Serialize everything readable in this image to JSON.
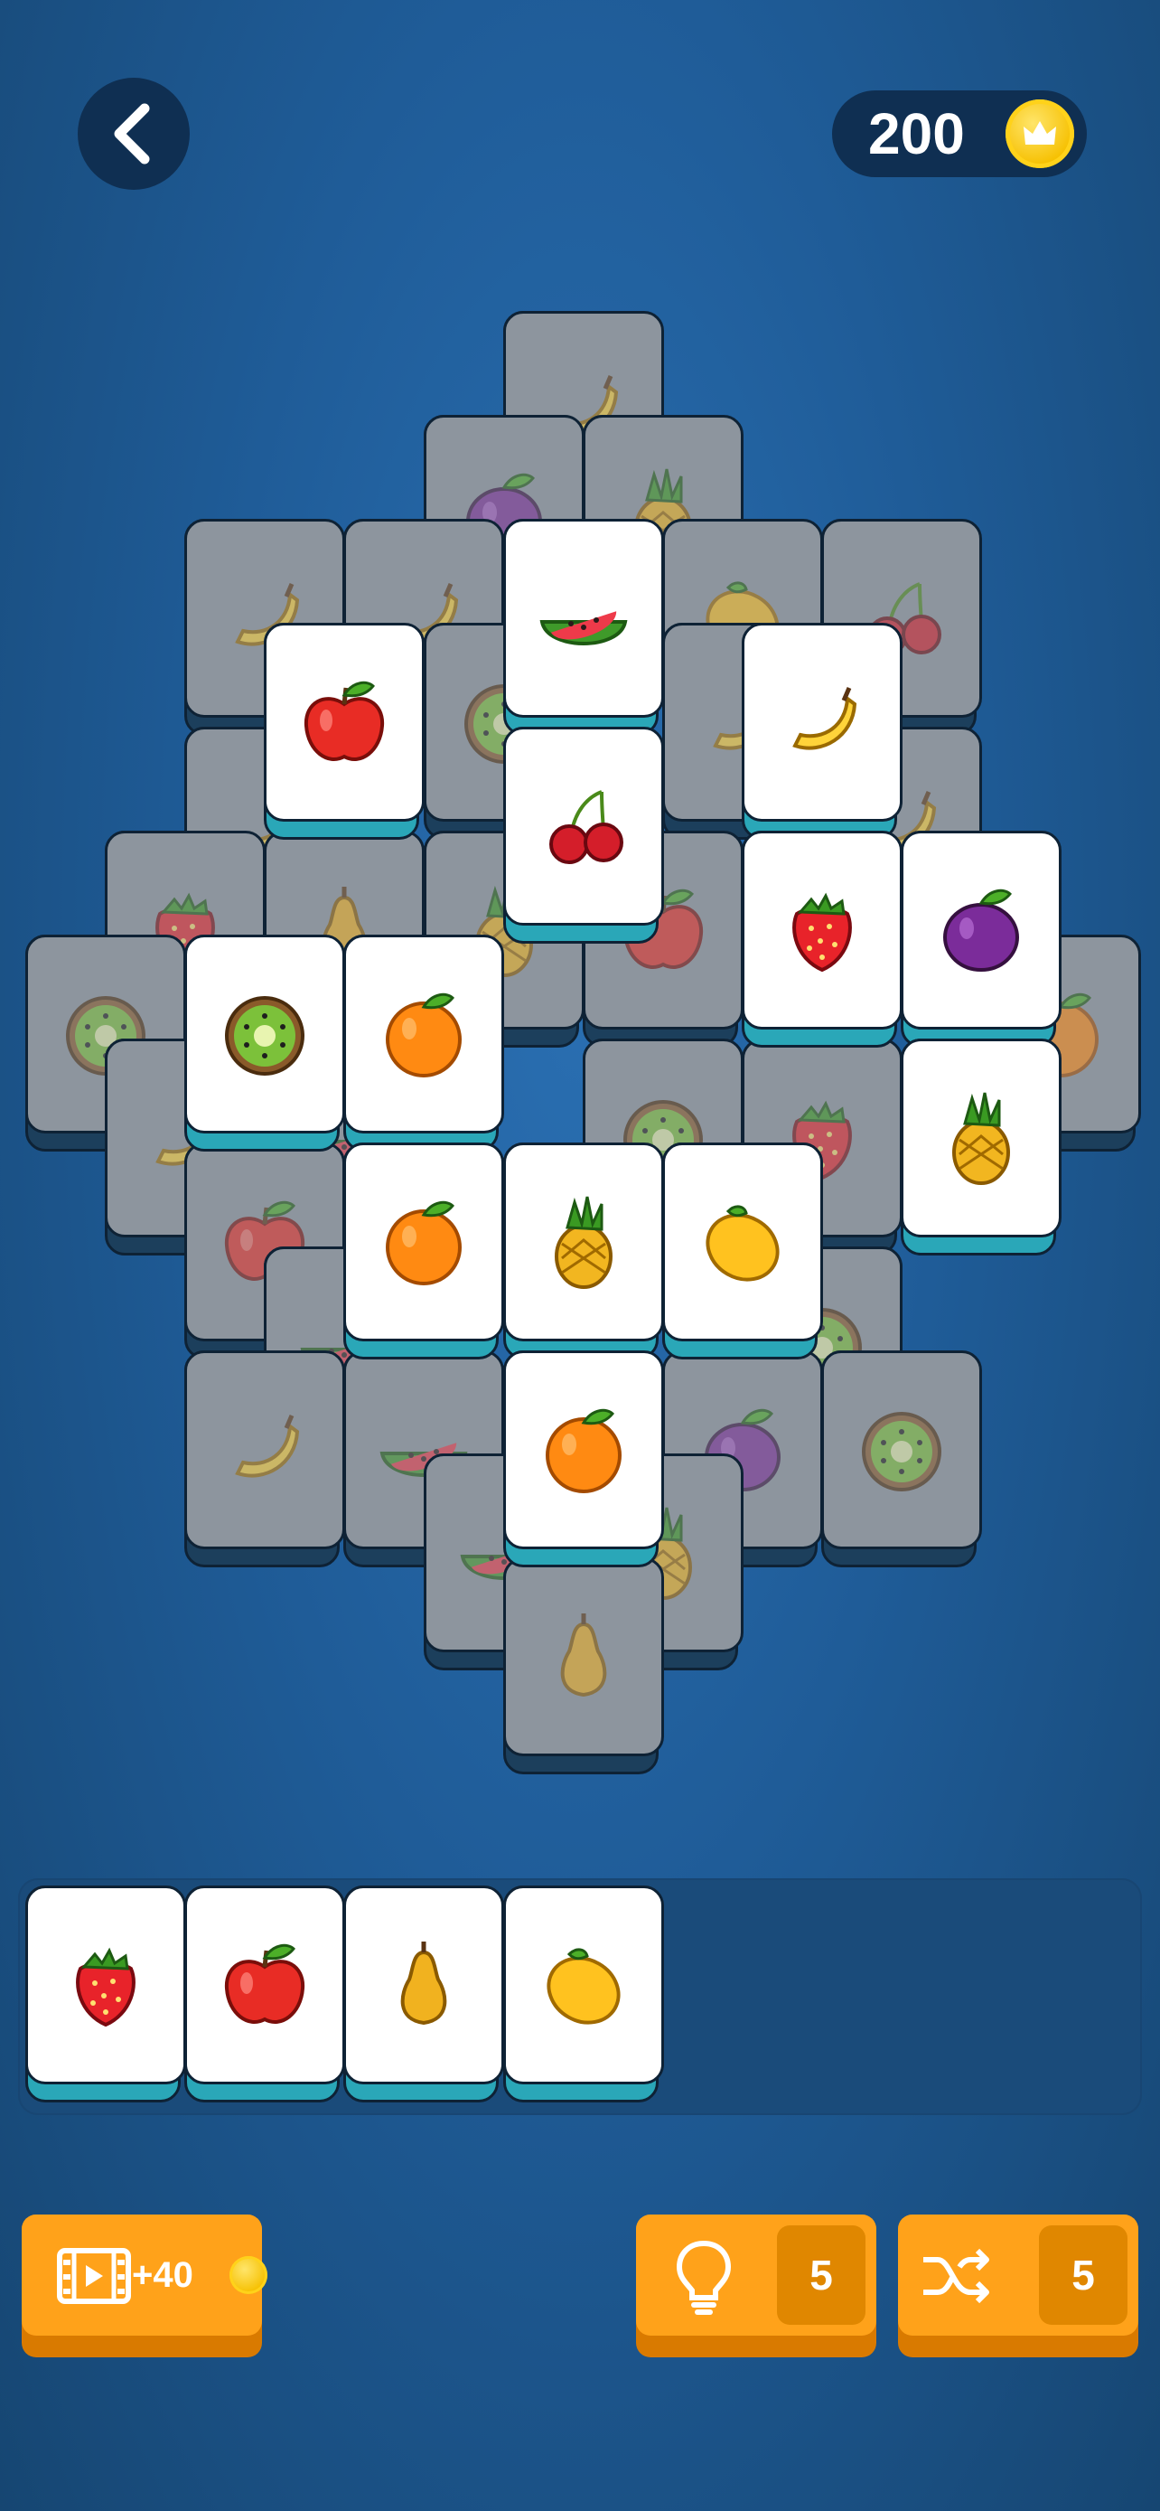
{
  "header": {
    "back_icon": "chevron-left-icon",
    "coins": "200",
    "coin_icon": "crown-coin-icon"
  },
  "board": {
    "tiles": [
      {
        "fruit": "banana",
        "active": false
      },
      {
        "fruit": "plum",
        "active": false
      },
      {
        "fruit": "pineapple",
        "active": false
      },
      {
        "fruit": "banana",
        "active": false
      },
      {
        "fruit": "banana",
        "active": false
      },
      {
        "fruit": "lemon",
        "active": false
      },
      {
        "fruit": "cherry",
        "active": false
      },
      {
        "fruit": "kiwi",
        "active": false
      },
      {
        "fruit": "banana",
        "active": false
      },
      {
        "fruit": "banana",
        "active": false
      },
      {
        "fruit": "banana",
        "active": false
      },
      {
        "fruit": "strawberry",
        "active": false
      },
      {
        "fruit": "pear",
        "active": false
      },
      {
        "fruit": "pineapple",
        "active": false
      },
      {
        "fruit": "apple",
        "active": false
      },
      {
        "fruit": "kiwi",
        "active": false
      },
      {
        "fruit": "orange",
        "active": false
      },
      {
        "fruit": "banana",
        "active": false
      },
      {
        "fruit": "watermelon",
        "active": false
      },
      {
        "fruit": "kiwi",
        "active": false
      },
      {
        "fruit": "strawberry",
        "active": false
      },
      {
        "fruit": "apple",
        "active": false
      },
      {
        "fruit": "pineapple",
        "active": false
      },
      {
        "fruit": "watermelon",
        "active": false
      },
      {
        "fruit": "kiwi",
        "active": false
      },
      {
        "fruit": "banana",
        "active": false
      },
      {
        "fruit": "watermelon",
        "active": false
      },
      {
        "fruit": "plum",
        "active": false
      },
      {
        "fruit": "kiwi",
        "active": false
      },
      {
        "fruit": "watermelon",
        "active": false
      },
      {
        "fruit": "pineapple",
        "active": false
      },
      {
        "fruit": "pear",
        "active": false
      },
      {
        "fruit": "watermelon",
        "active": true
      },
      {
        "fruit": "apple",
        "active": true
      },
      {
        "fruit": "banana",
        "active": true
      },
      {
        "fruit": "cherry",
        "active": true
      },
      {
        "fruit": "strawberry",
        "active": true
      },
      {
        "fruit": "plum",
        "active": true
      },
      {
        "fruit": "kiwi",
        "active": true
      },
      {
        "fruit": "orange",
        "active": true
      },
      {
        "fruit": "pineapple",
        "active": true
      },
      {
        "fruit": "orange",
        "active": true
      },
      {
        "fruit": "pineapple",
        "active": true
      },
      {
        "fruit": "lemon",
        "active": true
      },
      {
        "fruit": "orange",
        "active": true
      }
    ]
  },
  "tray": {
    "slots": [
      "strawberry",
      "apple",
      "pear",
      "lemon"
    ]
  },
  "buttons": {
    "video": {
      "icon": "film-video-icon",
      "reward": "+40",
      "coin_icon": "crown-coin-icon"
    },
    "hint": {
      "icon": "lightbulb-icon",
      "count": "5"
    },
    "shuffle": {
      "icon": "shuffle-icon",
      "count": "5"
    }
  }
}
